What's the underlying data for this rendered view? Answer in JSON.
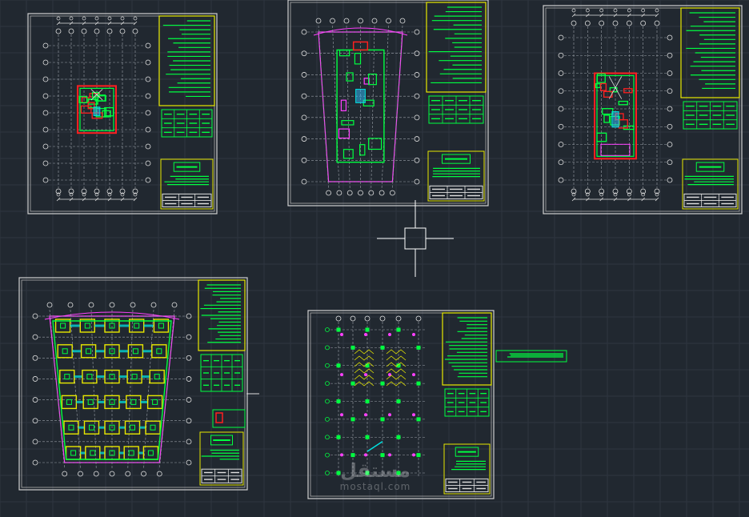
{
  "app": {
    "background": "#212830",
    "grid_color": "#2e3640",
    "cursor": "crosshair-cursor"
  },
  "colors": {
    "frame": "#d0d0d0",
    "green": "#00ff40",
    "yellow": "#e8e800",
    "red": "#ff2020",
    "cyan": "#00e0e0",
    "magenta": "#ff40ff",
    "white": "#e0e0e0",
    "dim": "#9aa0a8"
  },
  "sheets": [
    {
      "name": "sheet-floor-plan-1",
      "kind": "plan"
    },
    {
      "name": "sheet-ground-plan",
      "kind": "tapered"
    },
    {
      "name": "sheet-floor-plan-2",
      "kind": "plan"
    },
    {
      "name": "sheet-foundation-plan",
      "kind": "foundation"
    },
    {
      "name": "sheet-column-layout",
      "kind": "columns"
    }
  ],
  "watermark": {
    "logo": "مستقل",
    "url": "mostaql.com"
  }
}
